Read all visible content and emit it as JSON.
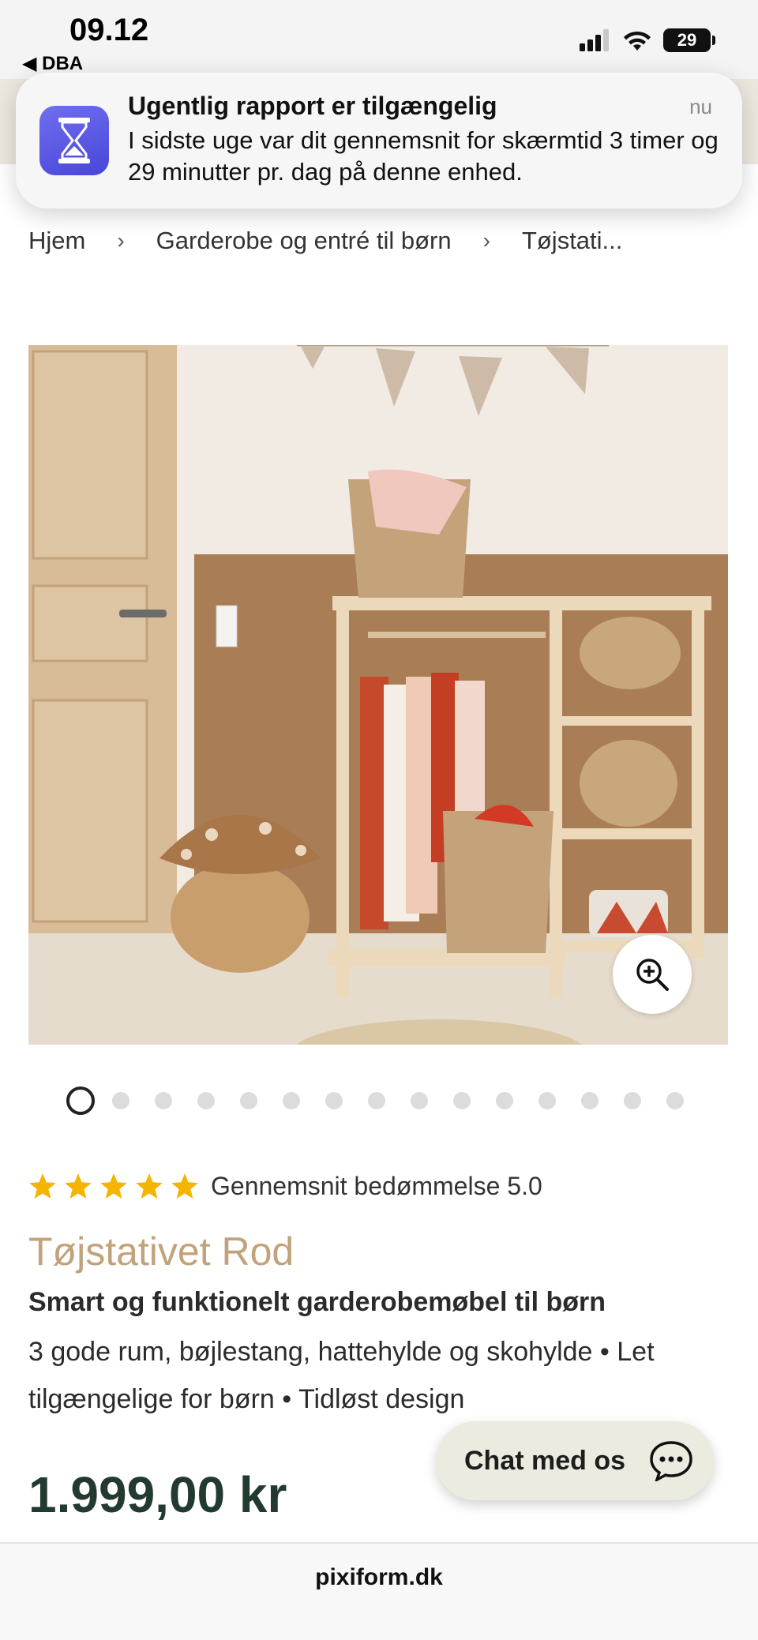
{
  "status_bar": {
    "time": "09.12",
    "back_label": "◀ DBA",
    "battery": "29"
  },
  "notification": {
    "title": "Ugentlig rapport er tilgængelig",
    "time": "nu",
    "body": "I sidste uge var dit gennemsnit for skærmtid 3 timer og 29 minutter pr. dag på denne enhed.",
    "icon": "hourglass-icon"
  },
  "breadcrumb": {
    "items": [
      "Hjem",
      "Garderobe og entré til børn",
      "Tøjstati..."
    ],
    "separator": "›"
  },
  "gallery": {
    "total_images": 15,
    "active_index": 0,
    "zoom_icon": "zoom-in-icon"
  },
  "rating": {
    "stars": 5,
    "label": "Gennemsnit bedømmelse 5.0",
    "star_color": "#f5b400"
  },
  "product": {
    "title": "Tøjstativet Rod",
    "subtitle": "Smart og funktionelt garderobemøbel til børn",
    "features": "3 gode rum, bøjlestang, hattehylde og skohylde • Let tilgængelige for børn • Tidløst design",
    "price": "1.999,00 kr"
  },
  "chat": {
    "label": "Chat med os",
    "icon": "chat-bubble-icon"
  },
  "browser": {
    "url": "pixiform.dk"
  },
  "colors": {
    "title_accent": "#c1a27a",
    "price": "#223a2f",
    "chat_bg": "#ecebe0"
  }
}
